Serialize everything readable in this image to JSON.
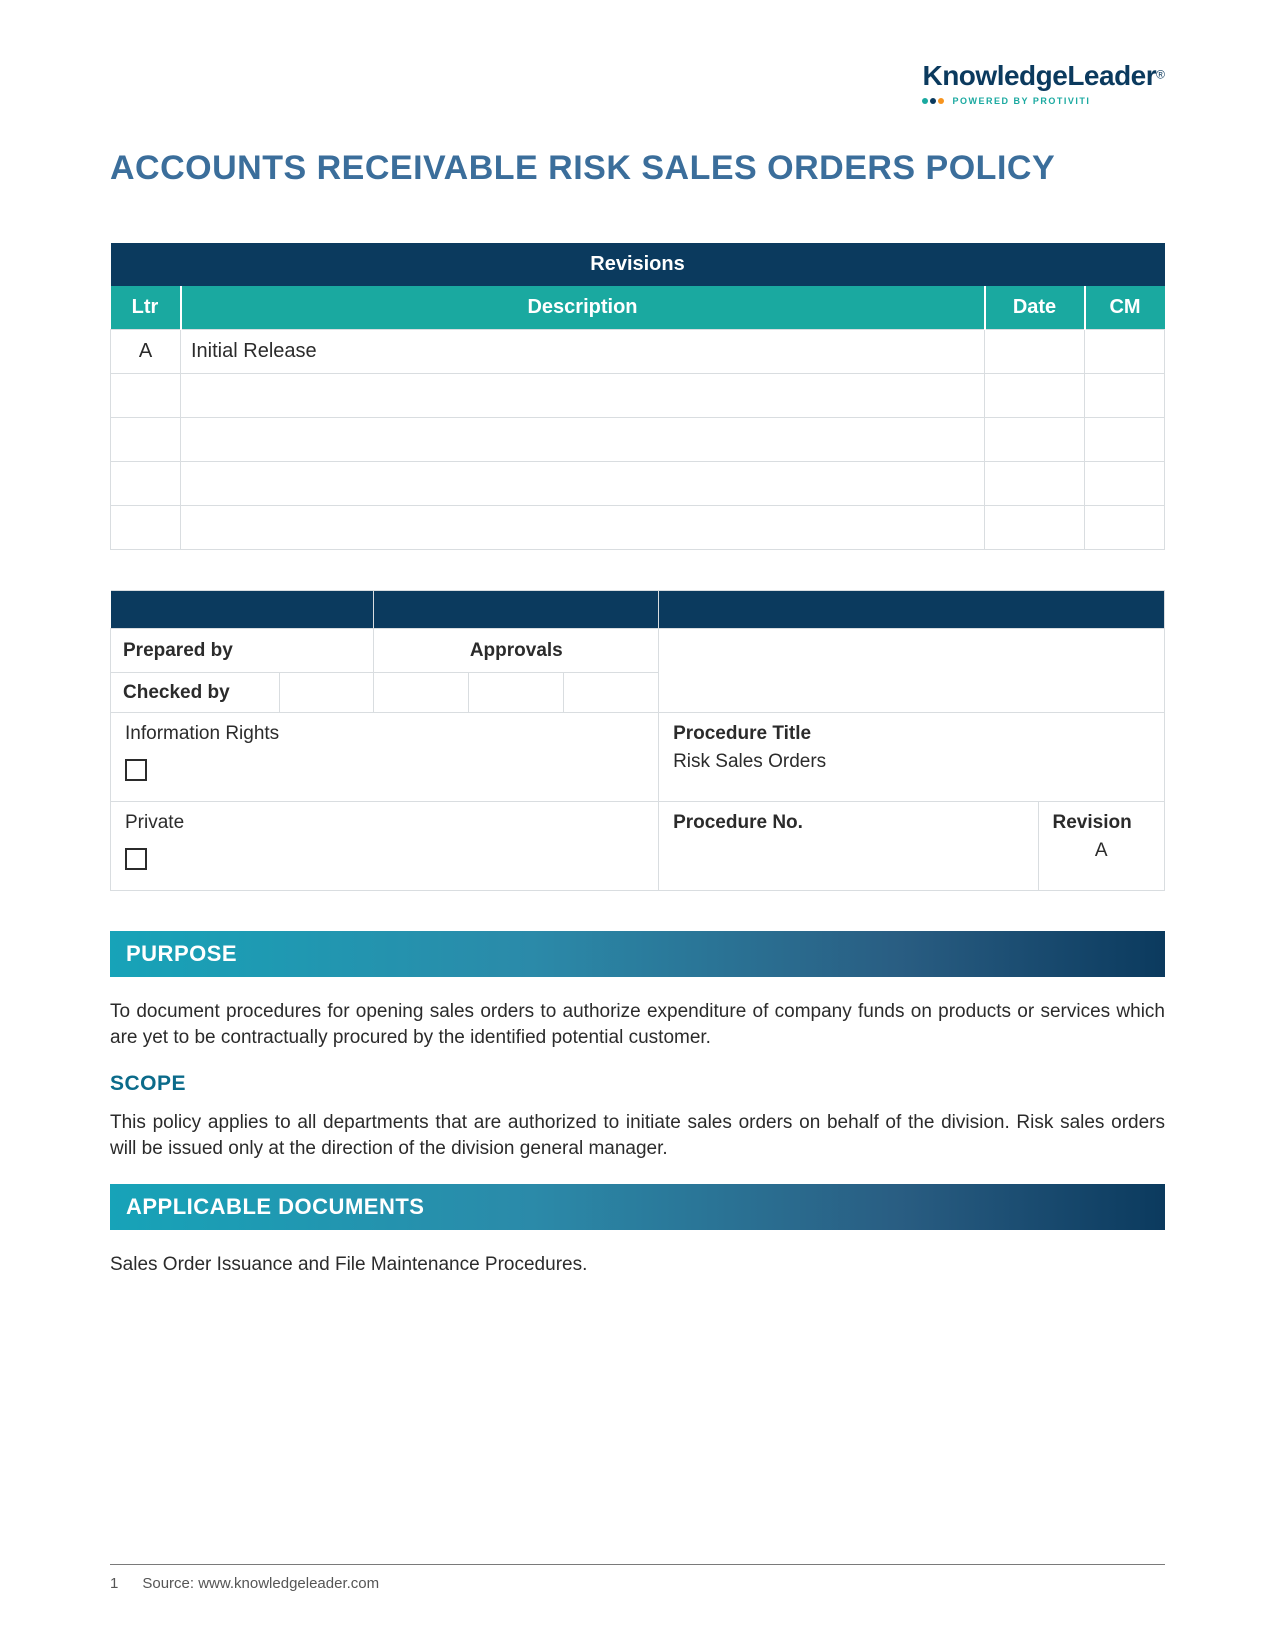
{
  "logo": {
    "main": "KnowledgeLeader",
    "reg": "®",
    "tag": "POWERED BY PROTIVITI"
  },
  "title": "ACCOUNTS RECEIVABLE RISK SALES ORDERS POLICY",
  "revisions": {
    "title": "Revisions",
    "headers": {
      "ltr": "Ltr",
      "desc": "Description",
      "date": "Date",
      "cm": "CM"
    },
    "rows": [
      {
        "ltr": "A",
        "desc": "Initial Release",
        "date": "",
        "cm": ""
      },
      {
        "ltr": "",
        "desc": "",
        "date": "",
        "cm": ""
      },
      {
        "ltr": "",
        "desc": "",
        "date": "",
        "cm": ""
      },
      {
        "ltr": "",
        "desc": "",
        "date": "",
        "cm": ""
      },
      {
        "ltr": "",
        "desc": "",
        "date": "",
        "cm": ""
      }
    ]
  },
  "meta": {
    "prepared_by": "Prepared by",
    "approvals": "Approvals",
    "checked_by": "Checked by",
    "info_rights": "Information Rights",
    "private": "Private",
    "proc_title_lbl": "Procedure Title",
    "proc_title_val": "Risk Sales Orders",
    "proc_no_lbl": "Procedure No.",
    "revision_lbl": "Revision",
    "revision_val": "A"
  },
  "sections": {
    "purpose": {
      "bar": "PURPOSE",
      "text": "To document procedures for opening sales orders to authorize expenditure of company funds on products or services which are yet to be contractually procured by the identified potential customer."
    },
    "scope": {
      "heading": "SCOPE",
      "text": "This policy applies to all departments that are authorized to initiate sales orders on behalf of the division. Risk sales orders will be issued only at the direction of the division general manager."
    },
    "applicable": {
      "bar": "APPLICABLE DOCUMENTS",
      "text": "Sales Order Issuance and File Maintenance Procedures."
    }
  },
  "footer": {
    "page": "1",
    "source": "Source: www.knowledgeleader.com"
  }
}
